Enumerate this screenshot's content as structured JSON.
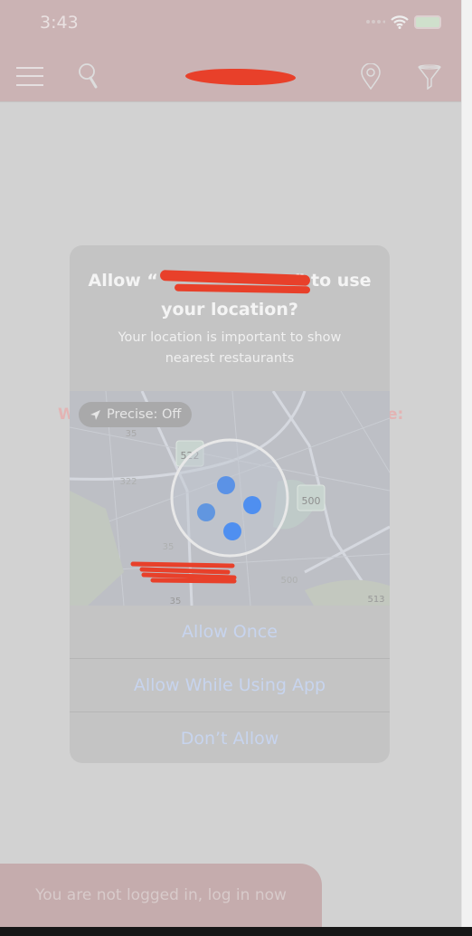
{
  "status_bar": {
    "time": "3:43",
    "icons": [
      "cellular-icon",
      "wifi-icon",
      "battery-charging-icon"
    ]
  },
  "top_bar": {
    "icons": [
      "menu-icon",
      "search-icon",
      "location-pin-icon",
      "filter-icon"
    ],
    "logo": "redacted"
  },
  "background": {
    "text_left": "W",
    "text_right": "e:"
  },
  "dialog": {
    "title_prefix": "Allow “",
    "title_suffix": "” to use",
    "title_line2": "your location?",
    "message": "Your location is important to show nearest restaurants",
    "precise_label": "Precise: Off",
    "map_labels": [
      "35",
      "522",
      "322",
      "500",
      "35",
      "500",
      "513",
      "35"
    ],
    "buttons": {
      "allow_once": "Allow Once",
      "allow_while_using": "Allow While Using App",
      "dont_allow": "Don’t Allow"
    }
  },
  "login_banner": {
    "text": "You are not logged in, log in now"
  },
  "colors": {
    "top_bar": "#cbb3b4",
    "button_text": "#c7d4ee",
    "location_dot": "#4f8ff0",
    "redaction": "#e8402a"
  }
}
